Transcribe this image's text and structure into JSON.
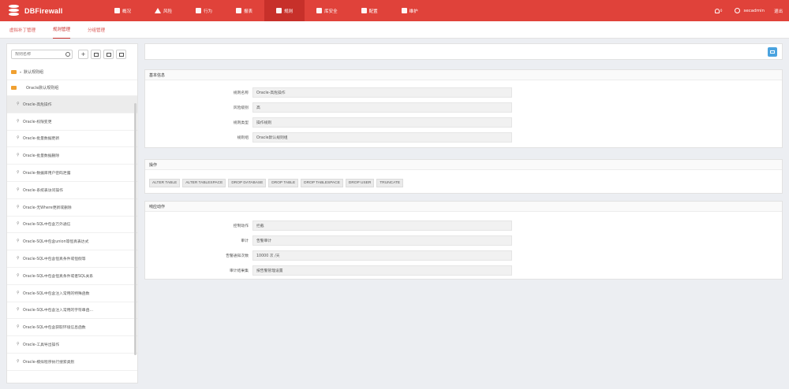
{
  "brand": {
    "name": "DBFirewall"
  },
  "nav": [
    {
      "label": "概况",
      "icon": "home-icon",
      "active": false
    },
    {
      "label": "风险",
      "icon": "warning-icon",
      "active": false
    },
    {
      "label": "行为",
      "icon": "check-icon",
      "active": false
    },
    {
      "label": "报表",
      "icon": "report-icon",
      "active": false
    },
    {
      "label": "规则",
      "icon": "rule-icon",
      "active": true
    },
    {
      "label": "库安全",
      "icon": "db-icon",
      "active": false
    },
    {
      "label": "配置",
      "icon": "wrench-icon",
      "active": false
    },
    {
      "label": "维护",
      "icon": "monitor-icon",
      "active": false
    }
  ],
  "topright": {
    "bell_count": "0",
    "username": "secadmin",
    "logout": "退出"
  },
  "subtabs": [
    {
      "label": "虚拟补丁管理",
      "active": false
    },
    {
      "label": "规则管理",
      "active": true
    },
    {
      "label": "分组管理",
      "active": false
    }
  ],
  "left": {
    "search_placeholder": "规则名称",
    "root_label": "默认规则组",
    "group_label": "Oracle默认规则组",
    "items": [
      "Oracle-高危操作",
      "Oracle-权限变更",
      "Oracle-批量数据更新",
      "Oracle-批量数据删除",
      "Oracle-数据库用户密码泄露",
      "Oracle-系统表访问操作",
      "Oracle-无Where更新或删除",
      "Oracle-SQL中包含万外通信",
      "Oracle-SQL中包含union等恒真表达式",
      "Oracle-SQL中包含恒真条件或恒假等",
      "Oracle-SQL中包含恒真条件或者SQL关系",
      "Oracle-SQL中包含注入常用的特殊函数",
      "Oracle-SQL中包含注入常用的字符串函...",
      "Oracle-SQL中包含获取环境信息函数",
      "Oracle-工具导出操作",
      "Oracle-模拟程序执行搜索类别"
    ]
  },
  "basic_info": {
    "title": "基本信息",
    "rows": [
      {
        "label": "规则名称",
        "value": "Oracle-高危操作"
      },
      {
        "label": "风险级别",
        "value": "高"
      },
      {
        "label": "规则类型",
        "value": "操作规则"
      },
      {
        "label": "规则组",
        "value": "Oracle默认规则组"
      }
    ]
  },
  "operations": {
    "title": "操作",
    "tags": [
      "ALTER TABLE",
      "ALTER TABLESPACE",
      "DROP DATABASE",
      "DROP TABLE",
      "DROP TABLESPACE",
      "DROP USER",
      "TRUNCATE"
    ]
  },
  "response": {
    "title": "响应动作",
    "rows": [
      {
        "label": "控制动作",
        "value": "拦截"
      },
      {
        "label": "审计",
        "value": "告警审计"
      },
      {
        "label": "告警通知次数",
        "value": "10000 次 /天"
      },
      {
        "label": "审计结果集",
        "value": "按告警管理设置"
      }
    ]
  }
}
